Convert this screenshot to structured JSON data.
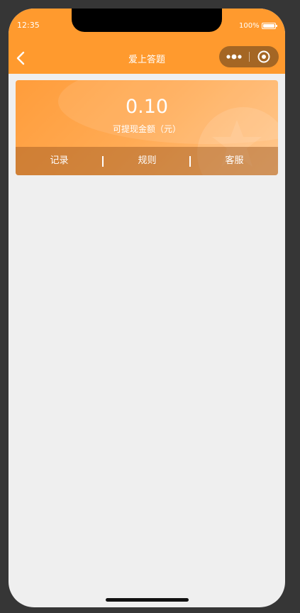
{
  "status_bar": {
    "time": "12:35",
    "battery": "100%"
  },
  "nav": {
    "title": "爱上答题",
    "back_icon": "chevron-left-icon",
    "more_icon": "more-dots-icon",
    "close_icon": "target-close-icon"
  },
  "balance": {
    "amount": "0.10",
    "label": "可提现金额（元）"
  },
  "actions": [
    {
      "label": "记录"
    },
    {
      "label": "规则"
    },
    {
      "label": "客服"
    }
  ],
  "colors": {
    "accent": "#ff9a2e",
    "background": "#efefef"
  }
}
